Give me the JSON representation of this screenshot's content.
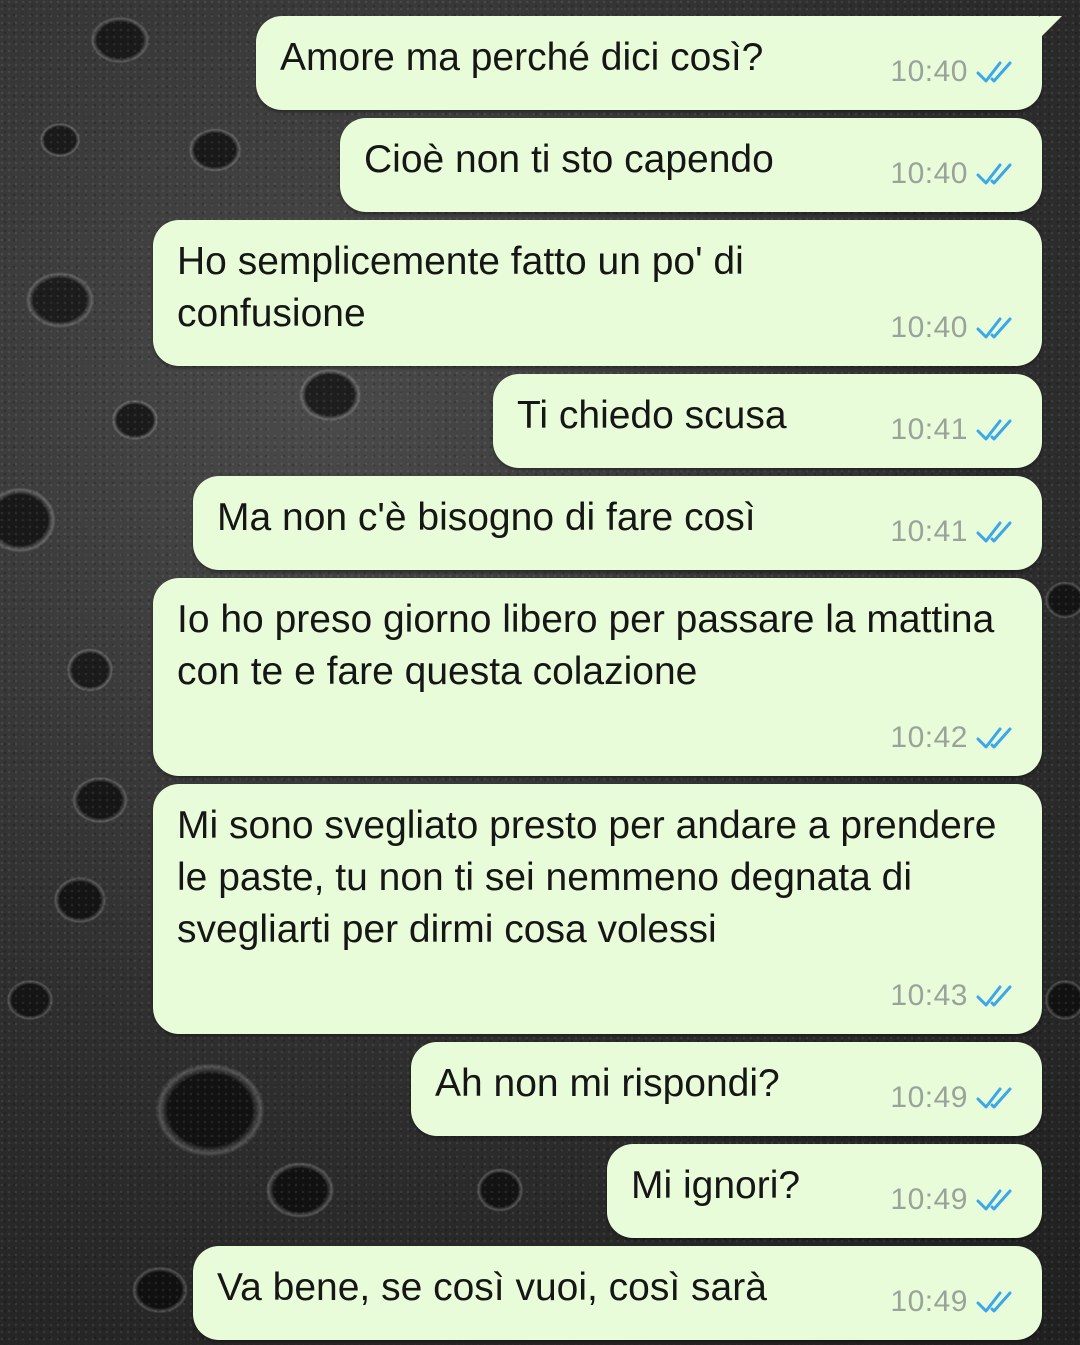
{
  "theme": {
    "bubble_color": "#e9fcd9",
    "tick_color": "#3aa7e8",
    "time_color": "#9aa39a"
  },
  "messages": [
    {
      "text": "Amore ma perché dici così?",
      "time": "10:40",
      "status": "read-double-tick"
    },
    {
      "text": "Cioè non ti sto capendo",
      "time": "10:40",
      "status": "read-double-tick"
    },
    {
      "text": "Ho semplicemente fatto un po' di confusione",
      "time": "10:40",
      "status": "read-double-tick"
    },
    {
      "text": "Ti chiedo scusa",
      "time": "10:41",
      "status": "read-double-tick"
    },
    {
      "text": "Ma non c'è bisogno di fare così",
      "time": "10:41",
      "status": "read-double-tick"
    },
    {
      "text": "Io ho preso giorno libero per passare la mattina con te e fare questa colazione",
      "time": "10:42",
      "status": "read-double-tick"
    },
    {
      "text": "Mi sono svegliato presto per andare a prendere le paste, tu non ti sei nemmeno degnata di svegliarti per dirmi cosa volessi",
      "time": "10:43",
      "status": "read-double-tick"
    },
    {
      "text": "Ah non mi rispondi?",
      "time": "10:49",
      "status": "read-double-tick"
    },
    {
      "text": "Mi ignori?",
      "time": "10:49",
      "status": "read-double-tick"
    },
    {
      "text": "Va bene, se così vuoi, così sarà",
      "time": "10:49",
      "status": "read-double-tick"
    }
  ]
}
